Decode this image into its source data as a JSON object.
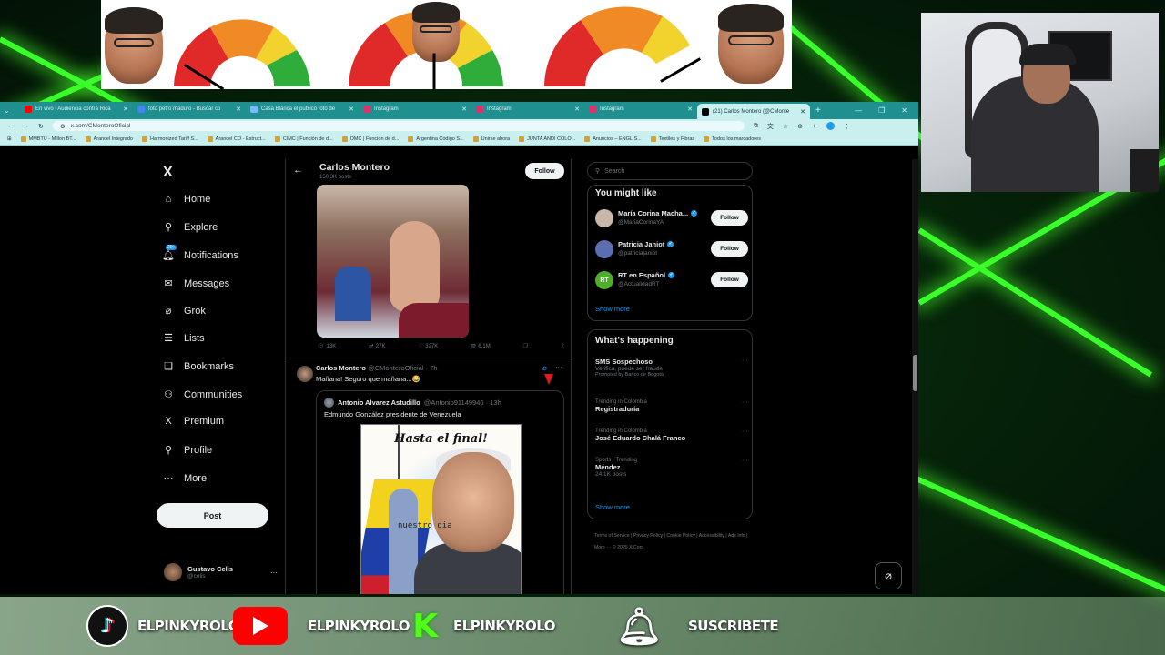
{
  "colors": {
    "x_blue": "#1d9bf0",
    "tab_teal": "#1f8f8f",
    "neon_green": "#39ff2a",
    "youtube_red": "#ff0000",
    "kick_green": "#53fc18"
  },
  "tabs": [
    {
      "label": "En vivo | Audiencia contra Rica",
      "color": "#ff0000",
      "active": false
    },
    {
      "label": "foto petro maduro - Buscar co",
      "color": "#4285f4",
      "active": false
    },
    {
      "label": "Casa Blanca el publicó foto de",
      "color": "#7ab8ff",
      "active": false
    },
    {
      "label": "Instagram",
      "color": "#e1306c",
      "active": false
    },
    {
      "label": "Instagram",
      "color": "#e1306c",
      "active": false
    },
    {
      "label": "Instagram",
      "color": "#e1306c",
      "active": false
    },
    {
      "label": "(21) Carlos Montero (@CMonte",
      "color": "#000000",
      "active": true
    }
  ],
  "address": {
    "url": "x.com/CMonteroOficial"
  },
  "bookmarks": [
    "MMBTU - Millon BT...",
    "Arancel Integrado",
    "Harmonized Tariff S...",
    "Arancel CO - Estruct...",
    "CIMC | Función de d...",
    "OMC | Función de d...",
    "Argentina Código S...",
    "Unirse ahora",
    "JUNTA ANDI COLO...",
    "Anuncios – ENGLIS...",
    "Textiles y Fibras",
    "Todos los marcadores"
  ],
  "nav": {
    "logo": "X",
    "items": [
      {
        "label": "Home",
        "icon": "⌂",
        "name": "home"
      },
      {
        "label": "Explore",
        "icon": "⚲",
        "name": "explore"
      },
      {
        "label": "Notifications",
        "icon": "🔔︎",
        "name": "notifications"
      },
      {
        "label": "Messages",
        "icon": "✉",
        "name": "messages"
      },
      {
        "label": "Grok",
        "icon": "⌀",
        "name": "grok"
      },
      {
        "label": "Lists",
        "icon": "☰",
        "name": "lists"
      },
      {
        "label": "Bookmarks",
        "icon": "❏",
        "name": "bookmarks"
      },
      {
        "label": "Communities",
        "icon": "⚇",
        "name": "communities"
      },
      {
        "label": "Premium",
        "icon": "X",
        "name": "premium"
      },
      {
        "label": "Profile",
        "icon": "⚲",
        "name": "profile"
      },
      {
        "label": "More",
        "icon": "⋯",
        "name": "more"
      }
    ],
    "notifications_badge": "20+",
    "post_label": "Post"
  },
  "account": {
    "name": "Gustavo Celis",
    "handle": "@celis___",
    "menu": "···"
  },
  "profile_header": {
    "name": "Carlos Montero",
    "posts": "150.3K posts",
    "follow": "Follow",
    "back": "←"
  },
  "tweet1": {
    "replies": "13K",
    "reposts": "27K",
    "likes": "327K",
    "views": "6.1M"
  },
  "tweet2": {
    "name": "Carlos Montero",
    "handle": "@CMonteroOficial · 7h",
    "text": "Mañana! Seguro que mañana...😂",
    "more": "···",
    "quote": {
      "name": "Antonio Alvarez Astudillo",
      "handle": "@Antonio91149946 · 13h",
      "text": "Edmundo González presidente de Venezuela",
      "image_title": "Hasta el final!",
      "image_scribble": "nuestro dia"
    }
  },
  "search": {
    "placeholder": "Search"
  },
  "you_might_like": {
    "title": "You might like",
    "items": [
      {
        "name": "María Corina Macha...",
        "handle": "@MariaCorinaYA",
        "follow": "Follow",
        "avatar_color": "#c9b6a8"
      },
      {
        "name": "Patricia Janiot",
        "handle": "@patriciajaniot",
        "follow": "Follow",
        "avatar_color": "#5b6fb0"
      },
      {
        "name": "RT en Español",
        "handle": "@ActualidadRT",
        "follow": "Follow",
        "avatar_color": "#4caf2a"
      }
    ],
    "rt_initials": "RT",
    "show_more": "Show more"
  },
  "whats_happening": {
    "title": "What's happening",
    "items": [
      {
        "context": "",
        "title": "SMS Sospechoso",
        "sub": "Verifica, puede ser fraude",
        "promoted": "Promoted by Banco de Bogotá"
      },
      {
        "context": "Trending in Colombia",
        "title": "Registraduría",
        "sub": "",
        "promoted": ""
      },
      {
        "context": "Trending in Colombia",
        "title": "José Eduardo Chalá Franco",
        "sub": "",
        "promoted": ""
      },
      {
        "context": "Sports · Trending",
        "title": "Méndez",
        "sub": "24.1K posts",
        "promoted": ""
      }
    ],
    "show_more": "Show more",
    "dots": "···"
  },
  "footer_links": "Terms of Service  |  Privacy Policy  |  Cookie Policy  |  Accessibility  |  Ads info  |  More ···  © 2025 X Corp.",
  "stream_bar": {
    "tiktok": "ELPINKYROLO",
    "youtube": "ELPINKYROLO",
    "kick": "ELPINKYROLO",
    "subscribe": "SUSCRIBETE",
    "kick_letter": "K"
  }
}
